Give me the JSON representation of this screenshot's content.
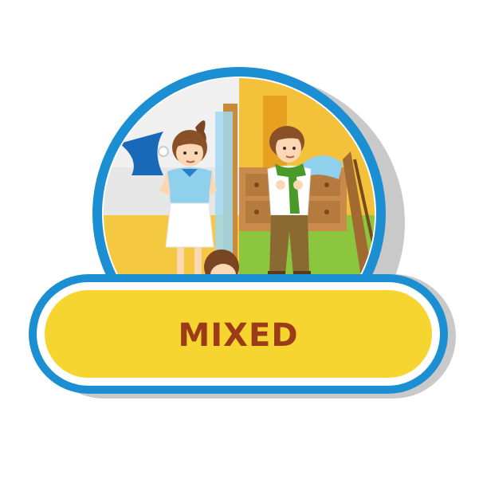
{
  "badge": {
    "label": "MIXED",
    "colors": {
      "border_blue": "#1b8fd2",
      "shadow_gray": "#c9c9c9",
      "banner_yellow": "#f7d531",
      "label_text": "#9c3b18"
    },
    "illustration": {
      "subject": "girl-and-boy-trying-clothes-in-room",
      "icons": [
        "girl-figure-icon",
        "boy-figure-icon",
        "mirror-icon",
        "dresser-icon",
        "child-head-icon"
      ]
    }
  }
}
